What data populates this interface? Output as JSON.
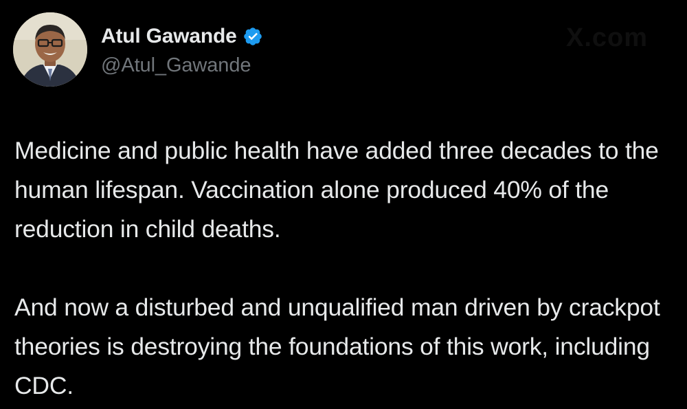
{
  "author": {
    "name": "Atul Gawande",
    "handle": "@Atul_Gawande",
    "verified": true,
    "verified_color": "#1d9bf0",
    "avatar_icon": "profile-photo"
  },
  "watermark": "X.com",
  "tweet": {
    "paragraphs": [
      "Medicine and public health have added three decades to the human lifespan. Vaccination alone produced 40% of the reduction in child deaths.",
      "And now a disturbed and unqualified man driven by crackpot theories is destroying the foundations of this work, including CDC."
    ]
  },
  "colors": {
    "background": "#000000",
    "text": "#e7e9ea",
    "secondary_text": "#71767b"
  }
}
